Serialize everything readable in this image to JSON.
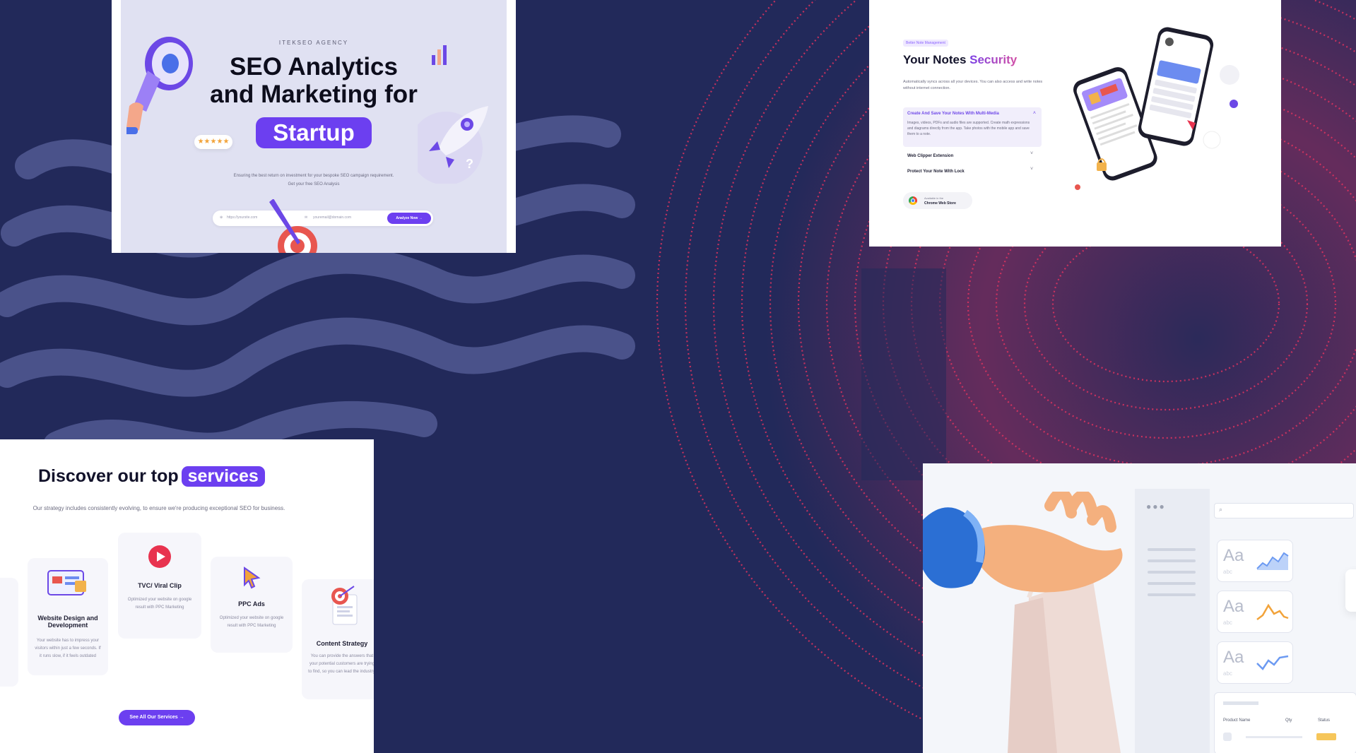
{
  "seo_hero": {
    "eyebrow": "ITEKSEO AGENCY",
    "headline_line1": "SEO Analytics",
    "headline_line2": "and Marketing for",
    "headline_highlight": "Startup",
    "rating_badge": "★★★★★",
    "subtext_line1": "Ensuring the best return on investment for your bespoke SEO campaign requirement.",
    "subtext_line2": "Get your free SEO Analysis",
    "url_placeholder": "https://yoursite.com",
    "email_placeholder": "youremail@domain.com",
    "cta_label": "Analyze Now →"
  },
  "notes": {
    "tag": "Better Note Management",
    "title": "Your Notes ",
    "title_accent": "Security",
    "description": "Automatically syncs across all your devices. You can also access and write notes without internet connection.",
    "accordion": [
      {
        "title": "Create And Save Your Notes With Multi-Media",
        "body": "Images, videos, PDFs and audio files are supported. Create math expressions and diagrams directly from the app. Take photos with the mobile app and save them to a note.",
        "expanded": true
      },
      {
        "title": "Web Clipper Extension",
        "expanded": false
      },
      {
        "title": "Protect Your Note With Lock",
        "expanded": false
      }
    ],
    "store_small": "Available in the",
    "store_name": "Chrome Web Store"
  },
  "services": {
    "title": "Discover our top",
    "title_highlight": "services",
    "description": "Our strategy includes consistently evolving, to ensure we're producing exceptional SEO for business.",
    "items": [
      {
        "name": "Website Design and Development",
        "desc": "Your website has to impress your visitors within just a few seconds. If it runs slow, if it feels outdated"
      },
      {
        "name": "TVC/ Viral Clip",
        "desc": "Optimized your website on google result with PPC Marketing"
      },
      {
        "name": "PPC Ads",
        "desc": "Optimized your website on google result with PPC Marketing"
      },
      {
        "name": "Content Strategy",
        "desc": "You can provide the answers that your potential customers are trying to find, so you can lead the industry."
      }
    ],
    "cta_label": "See All Our Services →"
  },
  "dashboard": {
    "font_sample": "Aa",
    "font_sub": "abc",
    "col_product": "Product Name",
    "col_qty": "Qty",
    "col_status": "Status"
  },
  "colors": {
    "background": "#22295a",
    "accent_purple": "#6c3ff0",
    "pink_wave": "#e0335f"
  }
}
